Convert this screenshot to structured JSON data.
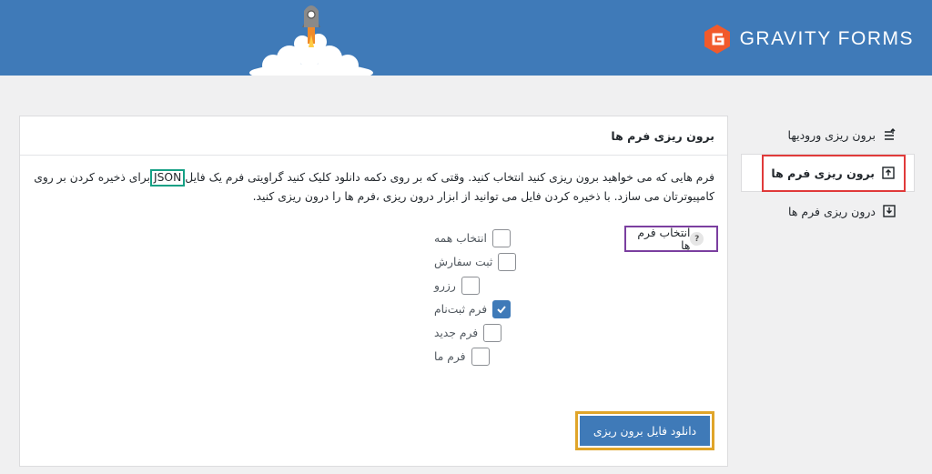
{
  "header": {
    "brand_text": "GRAVITY FORMS",
    "color": "#3f7ab8"
  },
  "nav": {
    "items": [
      {
        "label": "برون ریزی ورودیها",
        "icon": "export-entries-icon",
        "active": false
      },
      {
        "label": "برون ریزی فرم ها",
        "icon": "export-upload-icon",
        "active": true
      },
      {
        "label": "درون ریزی فرم ها",
        "icon": "import-download-icon",
        "active": false
      }
    ]
  },
  "panel": {
    "title": "برون ریزی فرم ها",
    "desc_part1": "فرم هایی که می خواهید برون ریزی کنید انتخاب کنید. وقتی که بر روی دکمه دانلود کلیک کنید گراویتی فرم یک فایل",
    "desc_json": "JSON",
    "desc_part2": "برای ذخیره کردن بر روی کامپیوترتان می سازد. با ذخیره کردن فایل می توانید از ابزار درون ریزی ،فرم ها را درون ریزی کنید.",
    "select_label": "انتخاب فرم ها",
    "help_glyph": "?",
    "forms": [
      {
        "label": "انتخاب همه",
        "checked": false
      },
      {
        "label": "ثبت سفارش",
        "checked": false
      },
      {
        "label": "رزرو",
        "checked": false
      },
      {
        "label": "فرم ثبت‌نام",
        "checked": true
      },
      {
        "label": "فرم جدید",
        "checked": false
      },
      {
        "label": "فرم ما",
        "checked": false
      }
    ],
    "download_label": "دانلود فایل برون ریزی"
  },
  "colors": {
    "accent": "#3f7ab8",
    "highlight_red": "#e03a3a",
    "highlight_green": "#16a085",
    "highlight_purple": "#7b3fa0",
    "highlight_orange": "#e0a52a"
  }
}
